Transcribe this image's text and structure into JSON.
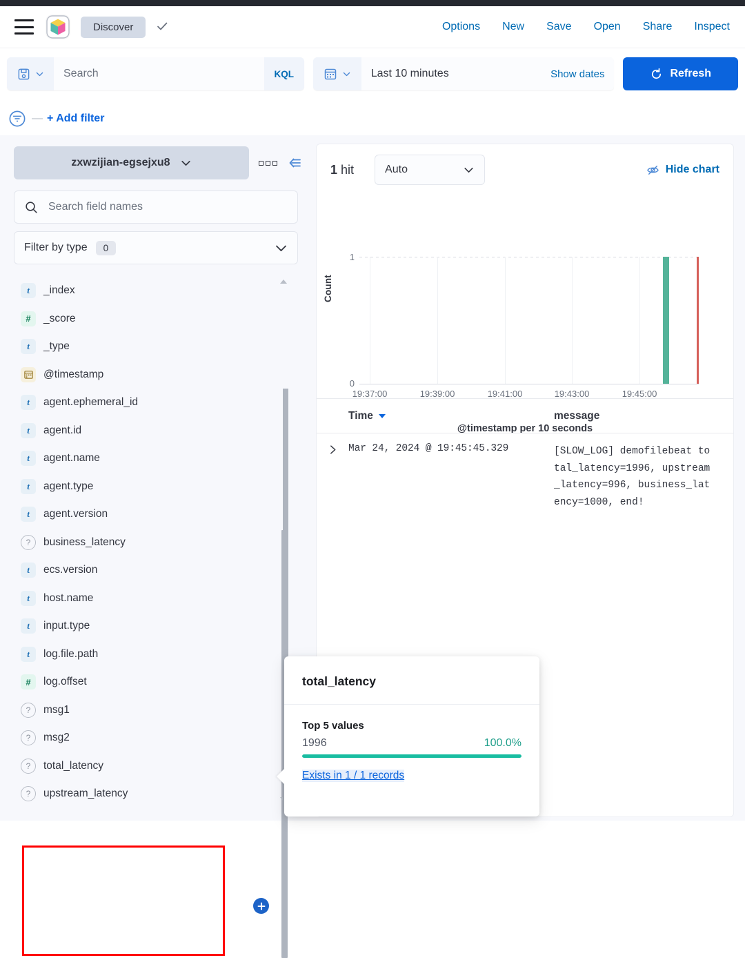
{
  "header": {
    "menu_icon": "hamburger-menu-icon",
    "logo": "kibana-logo",
    "app_name": "Discover",
    "check_icon": "check-icon",
    "links": [
      "Options",
      "New",
      "Save",
      "Open",
      "Share",
      "Inspect"
    ]
  },
  "query_bar": {
    "save_query_icon": "save-disk-icon",
    "search_placeholder": "Search",
    "search_value": "",
    "language_badge": "KQL",
    "calendar_icon": "calendar-icon",
    "date_range": "Last 10 minutes",
    "show_dates": "Show dates",
    "refresh_label": "Refresh",
    "refresh_icon": "refresh-icon",
    "refresh_color": "#0b64dd"
  },
  "filter_bar": {
    "filter_icon": "filter-icon",
    "dash": "—",
    "add_filter": "+ Add filter"
  },
  "sidebar": {
    "index_pattern": "zxwzijian-egsejxu8",
    "index_chevron": "chevron-down-icon",
    "options_icon": "grid-options-icon",
    "collapse_icon": "collapse-left-icon",
    "field_search_placeholder": "Search field names",
    "field_search_value": "",
    "field_search_icon": "search-icon",
    "filter_by_type_label": "Filter by type",
    "filter_by_type_count": "0",
    "filter_by_type_chevron": "chevron-down-icon",
    "fields": [
      {
        "name": "_index",
        "type": "string",
        "glyph": "t"
      },
      {
        "name": "_score",
        "type": "number",
        "glyph": "#"
      },
      {
        "name": "_type",
        "type": "string",
        "glyph": "t"
      },
      {
        "name": "@timestamp",
        "type": "date",
        "glyph": "📅"
      },
      {
        "name": "agent.ephemeral_id",
        "type": "string",
        "glyph": "t"
      },
      {
        "name": "agent.id",
        "type": "string",
        "glyph": "t"
      },
      {
        "name": "agent.name",
        "type": "string",
        "glyph": "t"
      },
      {
        "name": "agent.type",
        "type": "string",
        "glyph": "t"
      },
      {
        "name": "agent.version",
        "type": "string",
        "glyph": "t"
      },
      {
        "name": "business_latency",
        "type": "unknown",
        "glyph": "?"
      },
      {
        "name": "ecs.version",
        "type": "string",
        "glyph": "t"
      },
      {
        "name": "host.name",
        "type": "string",
        "glyph": "t"
      },
      {
        "name": "input.type",
        "type": "string",
        "glyph": "t"
      },
      {
        "name": "log.file.path",
        "type": "string",
        "glyph": "t"
      },
      {
        "name": "log.offset",
        "type": "number",
        "glyph": "#"
      },
      {
        "name": "msg1",
        "type": "unknown",
        "glyph": "?"
      },
      {
        "name": "msg2",
        "type": "unknown",
        "glyph": "?"
      },
      {
        "name": "total_latency",
        "type": "unknown",
        "glyph": "?"
      },
      {
        "name": "upstream_latency",
        "type": "unknown",
        "glyph": "?"
      }
    ],
    "highlight_color": "#ff0000",
    "add_field_button_icon": "plus-icon"
  },
  "content": {
    "hits_count": "1",
    "hits_label": "hit",
    "interval": "Auto",
    "interval_chevron": "chevron-down-icon",
    "hide_chart_label": "Hide chart",
    "hide_chart_icon": "eye-slash-icon"
  },
  "chart_data": {
    "type": "bar",
    "title": "",
    "xlabel": "@timestamp per 10 seconds",
    "ylabel": "Count",
    "ylim": [
      0,
      1
    ],
    "yticks": [
      "0",
      "1"
    ],
    "xticks": [
      "19:37:00",
      "19:39:00",
      "19:41:00",
      "19:43:00",
      "19:45:00"
    ],
    "grid": true,
    "legend": "none",
    "bar_color": "#54b399",
    "end_marker_color": "#d6605a",
    "categories": [
      "19:45:40"
    ],
    "values": [
      1
    ],
    "annotations": [
      {
        "label": "current time end marker",
        "color": "#d6605a",
        "value": 1
      }
    ]
  },
  "doc_table": {
    "columns": [
      "Time",
      "message"
    ],
    "sort_icon": "caret-down-icon",
    "expand_icon": "chevron-right-icon",
    "rows": [
      {
        "time": "Mar 24, 2024 @ 19:45:45.329",
        "message": "[SLOW_LOG] demofilebeat total_latency=1996, upstream_latency=996, business_latency=1000, end!"
      }
    ]
  },
  "popover": {
    "field_name": "total_latency",
    "top_values_label": "Top 5 values",
    "values": [
      {
        "value": "1996",
        "percent": "100.0%",
        "bar_pct": 100
      }
    ],
    "exists_link": "Exists in 1 / 1 records",
    "bar_color": "#19bda1"
  }
}
